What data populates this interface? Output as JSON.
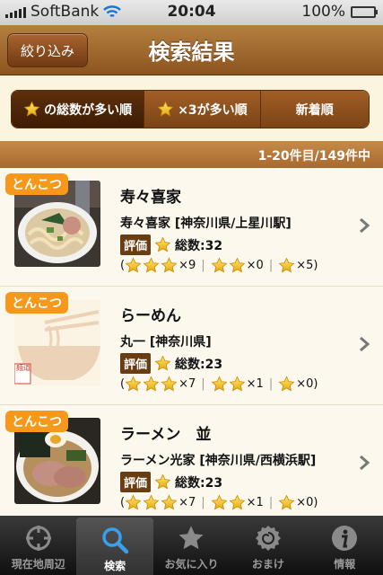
{
  "status": {
    "carrier": "SoftBank",
    "time": "20:04",
    "battery": "100%"
  },
  "nav": {
    "filter_label": "絞り込み",
    "title": "検索結果"
  },
  "segments": [
    {
      "label": "の総数が多い順",
      "icon": "star-icon",
      "selected": true
    },
    {
      "label": "×3が多い順",
      "icon": "star-icon",
      "selected": false
    },
    {
      "label": "新着順",
      "selected": false
    }
  ],
  "count_text": "1-20件目/149件中",
  "items": [
    {
      "tag": "とんこつ",
      "name": "寿々喜家",
      "shop": "寿々喜家 [神奈川県/上星川駅]",
      "badge": "評価",
      "total": "総数:32",
      "c3": "×9",
      "c2": "×0",
      "c1": "×5",
      "image": "ramen-photo"
    },
    {
      "tag": "とんこつ",
      "name": "らーめん",
      "shop": "丸一 [神奈川県]",
      "badge": "評価",
      "total": "総数:23",
      "c3": "×7",
      "c2": "×1",
      "c1": "×0",
      "image": "placeholder-bowl",
      "stamp": "麺道"
    },
    {
      "tag": "とんこつ",
      "name": "ラーメン　並",
      "shop": "ラーメン光家 [神奈川県/西横浜駅]",
      "badge": "評価",
      "total": "総数:23",
      "c3": "×7",
      "c2": "×1",
      "c1": "×0",
      "image": "ramen-photo-2"
    }
  ],
  "tabs": [
    {
      "label": "現在地周辺",
      "icon": "crosshair-icon",
      "active": false
    },
    {
      "label": "検索",
      "icon": "search-icon",
      "active": true
    },
    {
      "label": "お気に入り",
      "icon": "star-icon",
      "active": false
    },
    {
      "label": "おまけ",
      "icon": "naruto-icon",
      "active": false
    },
    {
      "label": "情報",
      "icon": "info-icon",
      "active": false
    }
  ],
  "colors": {
    "nav": "#9a6028",
    "tag": "#f5981b",
    "badge": "#6a3c12",
    "star": "#f2c21b"
  }
}
